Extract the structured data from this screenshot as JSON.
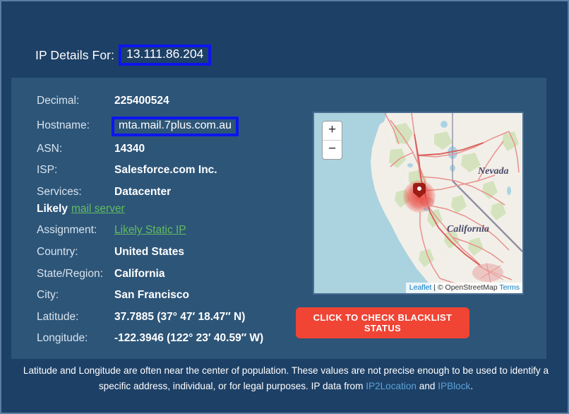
{
  "header": {
    "label": "IP Details For:",
    "ip": "13.111.86.204"
  },
  "details": {
    "rows": [
      {
        "key": "Decimal:",
        "value": "225400524"
      },
      {
        "key": "Hostname:",
        "value": "mta.mail.7plus.com.au"
      },
      {
        "key": "ASN:",
        "value": "14340"
      },
      {
        "key": "ISP:",
        "value": "Salesforce.com Inc."
      },
      {
        "key": "Services:",
        "value": "Datacenter"
      },
      {
        "key": "Assignment:",
        "value": "Likely Static IP"
      },
      {
        "key": "Country:",
        "value": "United States"
      },
      {
        "key": "State/Region:",
        "value": "California"
      },
      {
        "key": "City:",
        "value": "San Francisco"
      },
      {
        "key": "Latitude:",
        "value": "37.7885 (37° 47′ 18.47″ N)"
      },
      {
        "key": "Longitude:",
        "value": "-122.3946 (122° 23′ 40.59″ W)"
      }
    ],
    "likely_prefix": "Likely",
    "likely_link": "mail server"
  },
  "map": {
    "zoom_in": "+",
    "zoom_out": "−",
    "attribution_leaflet": "Leaflet",
    "attribution_separator": " | © ",
    "attribution_osm": "OpenStreetMap",
    "attribution_terms": "Terms",
    "labels": {
      "nevada": "Nevada",
      "california": "California"
    }
  },
  "button": {
    "blacklist_label": "CLICK TO CHECK BLACKLIST STATUS"
  },
  "footer": {
    "text_part1": "Latitude and Longitude are often near the center of population. These values are not precise enough to be used to identify a specific address, individual, or for legal purposes. IP data from ",
    "link1": "IP2Location",
    "text_part2": " and ",
    "link2": "IPBlock",
    "text_part3": "."
  },
  "colors": {
    "page_background": "#1d4066",
    "card_background": "#2d5578",
    "highlight_box": "#0b16ef",
    "link_green": "#62bd5f",
    "link_blue": "#5aa2d8",
    "button_red": "#f04434"
  }
}
